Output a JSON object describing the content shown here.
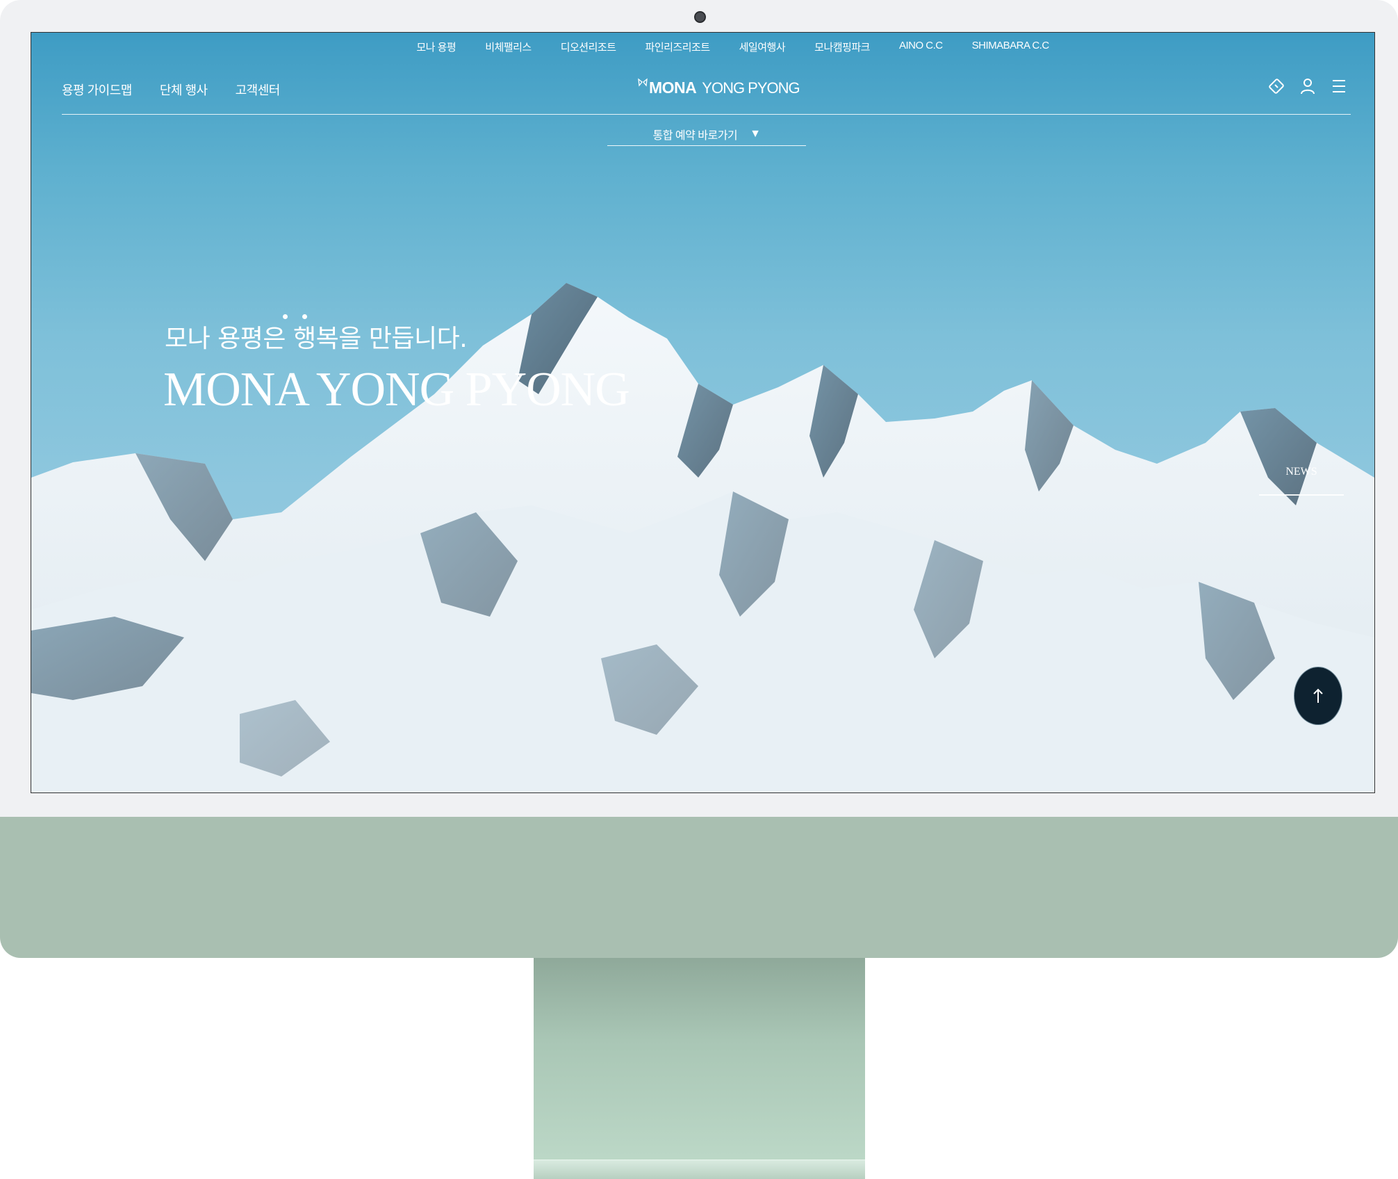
{
  "site_links": [
    "모나 용평",
    "비체팰리스",
    "디오션리조트",
    "파인리즈리조트",
    "세일여행사",
    "모나캠핑파크",
    "AINO C.C",
    "SHIMABARA C.C"
  ],
  "header": {
    "nav": [
      "용평 가이드맵",
      "단체 행사",
      "고객센터"
    ],
    "logo_bold": "MONA",
    "logo_regular": "YONG PYONG",
    "icons": [
      "ticket-icon",
      "user-icon",
      "menu-icon"
    ]
  },
  "quick_reservation": {
    "label": "통합 예약 바로가기",
    "arrow": "▼"
  },
  "hero": {
    "tagline": "모나 용평은 행복을 만듭니다.",
    "title": "MONA YONG PYONG",
    "news_label": "NEWS",
    "top_button_icon": "arrow-up-icon"
  },
  "colors": {
    "sky_top": "#3e9cc4",
    "sky_bottom": "#9bcbdc",
    "monitor_bezel": "#f0f1f3",
    "monitor_chin": "#a9bfb1",
    "stand": "#a9c6b5",
    "top_button": "#0e2230"
  }
}
